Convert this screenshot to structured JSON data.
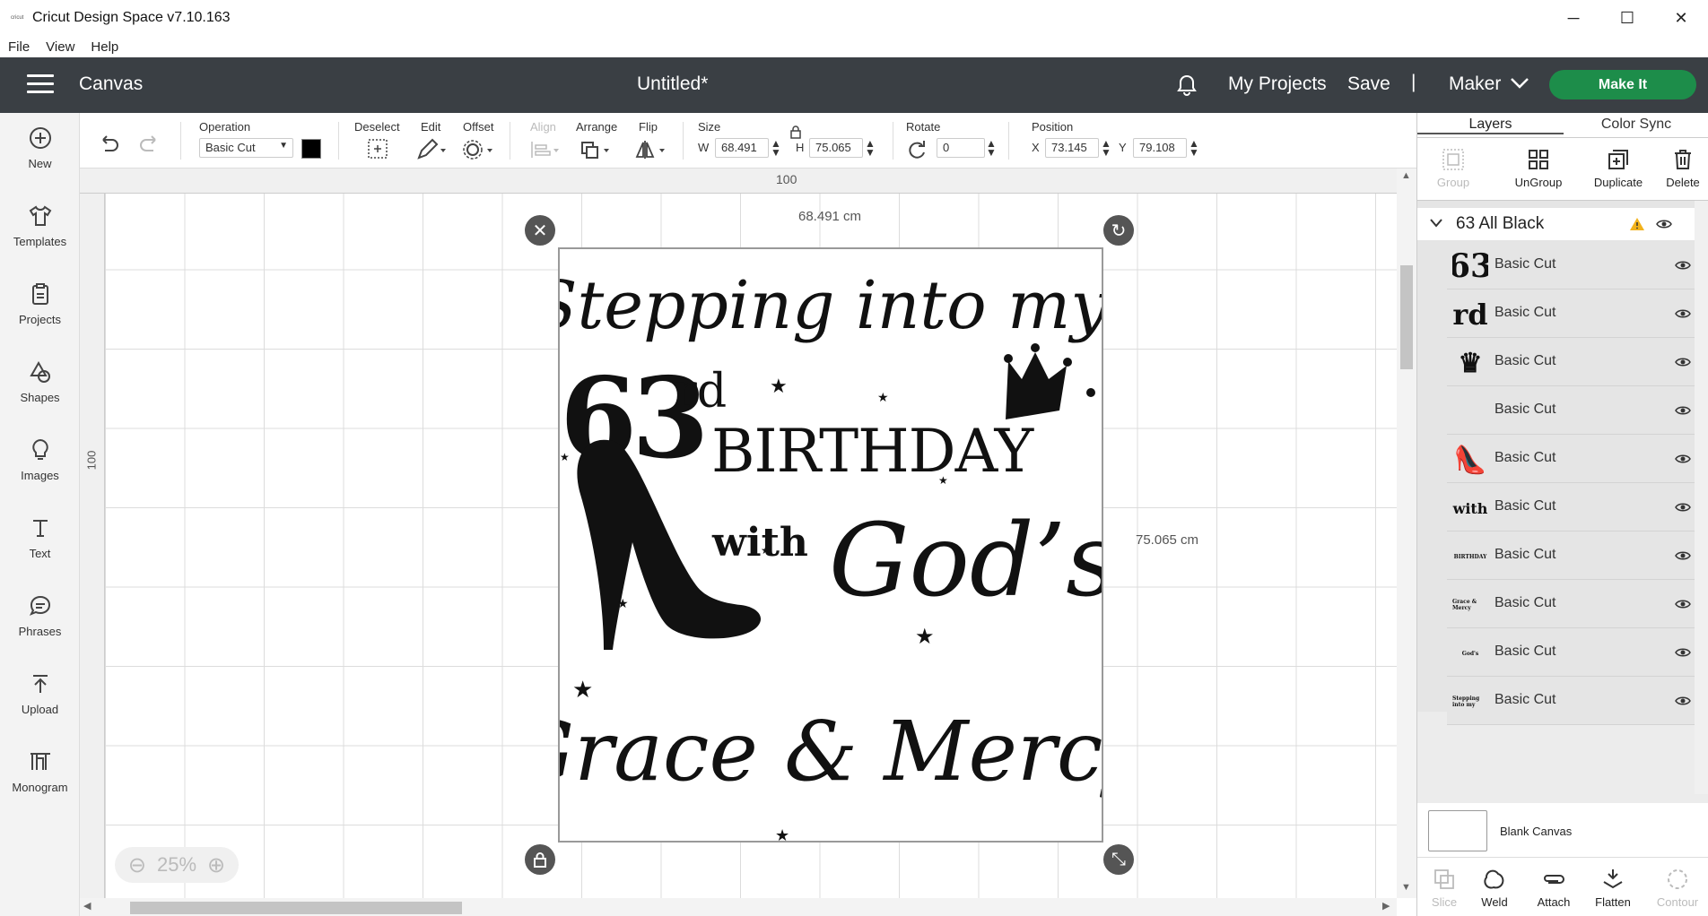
{
  "window": {
    "title": "Cricut Design Space  v7.10.163",
    "logo_text": "cricut",
    "min_label": "─",
    "max_label": "☐",
    "close_label": "✕"
  },
  "menu": [
    "File",
    "View",
    "Help"
  ],
  "header": {
    "section": "Canvas",
    "document_title": "Untitled*",
    "my_projects": "My Projects",
    "save": "Save",
    "separator": "|",
    "machine": "Maker",
    "make_it": "Make It"
  },
  "left_tools": [
    {
      "label": "New",
      "icon": "plus-circle-icon"
    },
    {
      "label": "Templates",
      "icon": "shirt-icon"
    },
    {
      "label": "Projects",
      "icon": "clipboard-icon"
    },
    {
      "label": "Shapes",
      "icon": "shapes-icon"
    },
    {
      "label": "Images",
      "icon": "bulb-icon"
    },
    {
      "label": "Text",
      "icon": "text-icon"
    },
    {
      "label": "Phrases",
      "icon": "speech-bubble-icon"
    },
    {
      "label": "Upload",
      "icon": "upload-icon"
    },
    {
      "label": "Monogram",
      "icon": "monogram-icon"
    }
  ],
  "toolbar": {
    "operation_label": "Operation",
    "operation_value": "Basic Cut",
    "color": "#000000",
    "deselect_label": "Deselect",
    "edit_label": "Edit",
    "offset_label": "Offset",
    "align_label": "Align",
    "arrange_label": "Arrange",
    "flip_label": "Flip",
    "size_label": "Size",
    "w_label": "W",
    "w_value": "68.491",
    "h_label": "H",
    "h_value": "75.065",
    "rotate_label": "Rotate",
    "rotate_value": "0",
    "position_label": "Position",
    "x_label": "X",
    "x_value": "73.145",
    "y_label": "Y",
    "y_value": "79.108"
  },
  "canvas": {
    "ruler_top": "100",
    "ruler_left": "100",
    "width_dim": "68.491 cm",
    "height_dim": "75.065 cm",
    "zoom_minus": "⊖",
    "zoom": "25%",
    "zoom_plus": "⊕",
    "design": {
      "line1": "Stepping into my",
      "num": "63",
      "suffix": "rd",
      "birthday": "BIRTHDAY",
      "with": "with",
      "gods": "God’s",
      "grace": "Grace & Mercy"
    }
  },
  "panel": {
    "tab_layers": "Layers",
    "tab_colorsync": "Color Sync",
    "actions": [
      {
        "label": "Group",
        "enabled": false
      },
      {
        "label": "UnGroup",
        "enabled": true
      },
      {
        "label": "Duplicate",
        "enabled": true
      },
      {
        "label": "Delete",
        "enabled": true
      }
    ],
    "group_name": "63 All Black",
    "layers": [
      {
        "thumb": "63",
        "name": "Basic Cut"
      },
      {
        "thumb": "rd",
        "name": "Basic Cut"
      },
      {
        "thumb": "♛",
        "name": "Basic Cut"
      },
      {
        "thumb": "",
        "name": "Basic Cut"
      },
      {
        "thumb": "👠",
        "name": "Basic Cut"
      },
      {
        "thumb": "with",
        "name": "Basic Cut"
      },
      {
        "thumb": "BIRTHDAY",
        "name": "Basic Cut"
      },
      {
        "thumb": "Grace & Mercy",
        "name": "Basic Cut"
      },
      {
        "thumb": "God's",
        "name": "Basic Cut"
      },
      {
        "thumb": "Stepping into my",
        "name": "Basic Cut"
      }
    ],
    "blank_canvas": "Blank Canvas",
    "bottom_actions": [
      {
        "label": "Slice",
        "enabled": false
      },
      {
        "label": "Weld",
        "enabled": true
      },
      {
        "label": "Attach",
        "enabled": true
      },
      {
        "label": "Flatten",
        "enabled": true
      },
      {
        "label": "Contour",
        "enabled": false
      }
    ]
  }
}
